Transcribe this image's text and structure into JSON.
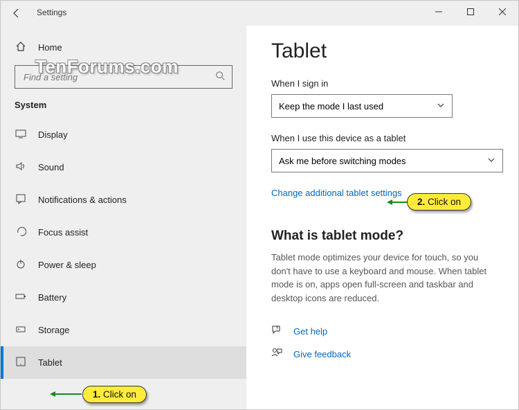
{
  "window": {
    "title": "Settings"
  },
  "sidebar": {
    "home": "Home",
    "search_placeholder": "Find a setting",
    "category": "System",
    "items": [
      {
        "label": "Display"
      },
      {
        "label": "Sound"
      },
      {
        "label": "Notifications & actions"
      },
      {
        "label": "Focus assist"
      },
      {
        "label": "Power & sleep"
      },
      {
        "label": "Battery"
      },
      {
        "label": "Storage"
      },
      {
        "label": "Tablet"
      }
    ]
  },
  "main": {
    "heading": "Tablet",
    "signin_label": "When I sign in",
    "signin_value": "Keep the mode I last used",
    "device_label": "When I use this device as a tablet",
    "device_value": "Ask me before switching modes",
    "link": "Change additional tablet settings",
    "what_heading": "What is tablet mode?",
    "what_body": "Tablet mode optimizes your device for touch, so you don't have to use a keyboard and mouse. When tablet mode is on, apps open full-screen and taskbar and desktop icons are reduced.",
    "help": "Get help",
    "feedback": "Give feedback"
  },
  "callouts": {
    "one": "1. Click on",
    "two": "2. Click on"
  },
  "watermark": "TenForums.com"
}
